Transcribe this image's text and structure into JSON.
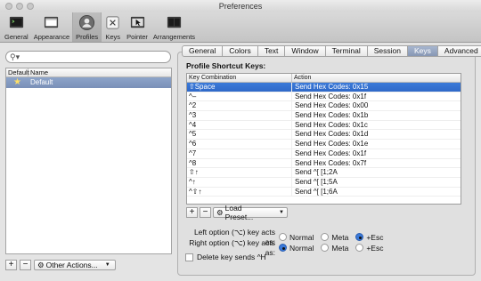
{
  "window": {
    "title": "Preferences"
  },
  "toolbar": {
    "items": [
      {
        "label": "General",
        "icon": "general-icon"
      },
      {
        "label": "Appearance",
        "icon": "appearance-icon"
      },
      {
        "label": "Profiles",
        "icon": "profiles-icon",
        "selected": true
      },
      {
        "label": "Keys",
        "icon": "keys-icon"
      },
      {
        "label": "Pointer",
        "icon": "pointer-icon"
      },
      {
        "label": "Arrangements",
        "icon": "arrangements-icon"
      }
    ]
  },
  "profiles": {
    "search_placeholder": "",
    "columns": [
      "Default",
      "Name"
    ],
    "rows": [
      {
        "default_marker": "★",
        "name": "Default"
      }
    ],
    "add_label": "+",
    "remove_label": "−",
    "other_actions_label": "Other Actions..."
  },
  "tabs": [
    "General",
    "Colors",
    "Text",
    "Window",
    "Terminal",
    "Session",
    "Keys",
    "Advanced"
  ],
  "selected_tab": "Keys",
  "keys": {
    "section_title": "Profile Shortcut Keys:",
    "columns": [
      "Key Combination",
      "Action"
    ],
    "rows": [
      {
        "combo": "⇧Space",
        "action": "Send Hex Codes: 0x15"
      },
      {
        "combo": "^–",
        "action": "Send Hex Codes: 0x1f"
      },
      {
        "combo": "^2",
        "action": "Send Hex Codes: 0x00"
      },
      {
        "combo": "^3",
        "action": "Send Hex Codes: 0x1b"
      },
      {
        "combo": "^4",
        "action": "Send Hex Codes: 0x1c"
      },
      {
        "combo": "^5",
        "action": "Send Hex Codes: 0x1d"
      },
      {
        "combo": "^6",
        "action": "Send Hex Codes: 0x1e"
      },
      {
        "combo": "^7",
        "action": "Send Hex Codes: 0x1f"
      },
      {
        "combo": "^8",
        "action": "Send Hex Codes: 0x7f"
      },
      {
        "combo": "⇧↑",
        "action": "Send ^[ [1;2A"
      },
      {
        "combo": "^↑",
        "action": "Send ^[ [1;5A"
      },
      {
        "combo": "^⇧↑",
        "action": "Send ^[ [1;6A"
      }
    ],
    "add_label": "+",
    "remove_label": "−",
    "load_preset_label": "Load Preset..."
  },
  "option_keys": {
    "left_label": "Left option (⌥) key acts as:",
    "right_label": "Right option (⌥) key acts as:",
    "choices": [
      "Normal",
      "Meta",
      "+Esc"
    ],
    "left_selected": "+Esc",
    "right_selected": "Normal"
  },
  "delete_key": {
    "label": "Delete key sends ^H",
    "checked": false
  }
}
